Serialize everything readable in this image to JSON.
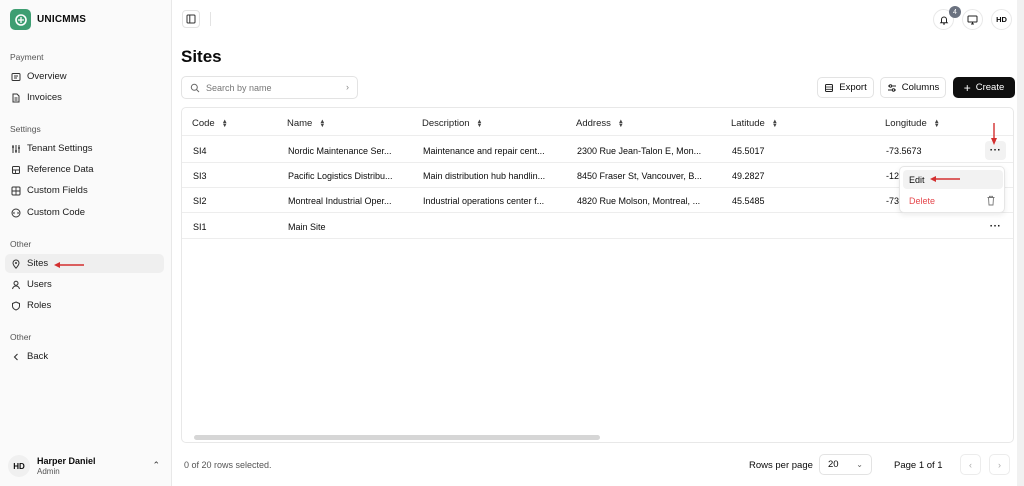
{
  "app": {
    "name": "UNICMMS"
  },
  "sidebar": {
    "sections": [
      {
        "label": "Payment",
        "items": [
          {
            "label": "Overview",
            "icon": "receipt-icon"
          },
          {
            "label": "Invoices",
            "icon": "document-icon"
          }
        ]
      },
      {
        "label": "Settings",
        "items": [
          {
            "label": "Tenant Settings",
            "icon": "sliders-icon"
          },
          {
            "label": "Reference Data",
            "icon": "database-icon"
          },
          {
            "label": "Custom Fields",
            "icon": "grid-icon"
          },
          {
            "label": "Custom Code",
            "icon": "code-icon"
          }
        ]
      },
      {
        "label": "Other",
        "items": [
          {
            "label": "Sites",
            "icon": "map-pin-icon",
            "active": true
          },
          {
            "label": "Users",
            "icon": "user-icon"
          },
          {
            "label": "Roles",
            "icon": "shield-icon"
          }
        ]
      },
      {
        "label": "Other",
        "items": [
          {
            "label": "Back",
            "icon": "chevron-left-icon"
          }
        ]
      }
    ],
    "user": {
      "initials": "HD",
      "name": "Harper Daniel",
      "role": "Admin"
    }
  },
  "topbar": {
    "notification_count": "4",
    "avatar_initials": "HD"
  },
  "page": {
    "title": "Sites"
  },
  "search": {
    "placeholder": "Search by name"
  },
  "toolbar": {
    "export_label": "Export",
    "columns_label": "Columns",
    "create_label": "Create"
  },
  "table": {
    "columns": [
      "Code",
      "Name",
      "Description",
      "Address",
      "Latitude",
      "Longitude"
    ],
    "rows": [
      [
        "SI4",
        "Nordic Maintenance Ser...",
        "Maintenance and repair cent...",
        "2300 Rue Jean-Talon E, Mon...",
        "45.5017",
        "-73.5673"
      ],
      [
        "SI3",
        "Pacific Logistics Distribu...",
        "Main distribution hub handlin...",
        "8450 Fraser St, Vancouver, B...",
        "49.2827",
        "-12"
      ],
      [
        "SI2",
        "Montreal Industrial Oper...",
        "Industrial operations center f...",
        "4820 Rue Molson, Montreal, ...",
        "45.5485",
        "-73"
      ],
      [
        "SI1",
        "Main Site",
        "",
        "",
        "",
        ""
      ]
    ]
  },
  "row_menu": {
    "edit_label": "Edit",
    "delete_label": "Delete"
  },
  "footer": {
    "selection_text": "0 of 20 rows selected.",
    "rows_per_page_label": "Rows per page",
    "rows_per_page_value": "20",
    "page_info": "Page 1 of 1"
  },
  "colors": {
    "accent": "#3e9e72",
    "annotation": "#d32f2f",
    "delete": "#e5484d",
    "primary_button": "#0f0f0f"
  }
}
